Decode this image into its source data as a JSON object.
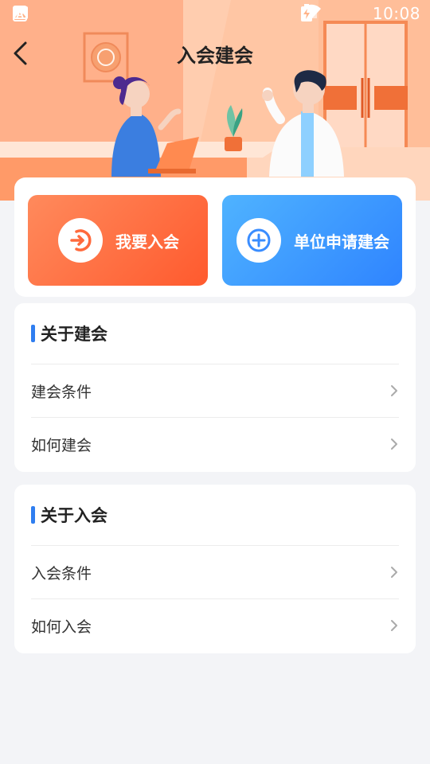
{
  "status_bar": {
    "time": "10:08",
    "icons": [
      "gallery-icon",
      "text-a-icon",
      "wifi-icon",
      "signal-icon",
      "battery-charging-icon"
    ]
  },
  "header": {
    "title": "入会建会"
  },
  "actions": [
    {
      "label": "我要入会",
      "icon": "login-arrow-icon",
      "color": "#ff6a3d"
    },
    {
      "label": "单位申请建会",
      "icon": "plus-circle-icon",
      "color": "#3a8dff"
    }
  ],
  "sections": [
    {
      "title": "关于建会",
      "items": [
        "建会条件",
        "如何建会"
      ]
    },
    {
      "title": "关于入会",
      "items": [
        "入会条件",
        "如何入会"
      ]
    }
  ],
  "colors": {
    "accent_blue": "#2f7ef0",
    "orange": "#ff6a3d",
    "background": "#f3f4f7"
  }
}
